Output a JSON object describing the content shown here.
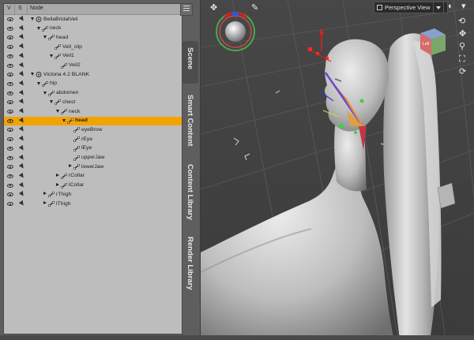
{
  "panel": {
    "columns": {
      "v": "V",
      "s": "S",
      "node": "Node"
    },
    "nodes": [
      {
        "label": "BellaBridalVeil",
        "level": 0,
        "type": "figure",
        "expanded": true,
        "selected": false
      },
      {
        "label": "neck",
        "level": 1,
        "type": "bone",
        "expanded": true,
        "selected": false
      },
      {
        "label": "head",
        "level": 2,
        "type": "bone",
        "expanded": true,
        "selected": false
      },
      {
        "label": "Veil_clip",
        "level": 3,
        "type": "bone",
        "expanded": false,
        "leaf": true,
        "selected": false
      },
      {
        "label": "Veil1",
        "level": 3,
        "type": "bone",
        "expanded": true,
        "selected": false
      },
      {
        "label": "Veil2",
        "level": 4,
        "type": "bone",
        "leaf": true,
        "selected": false
      },
      {
        "label": "Victoria 4.2 BLANK",
        "level": 0,
        "type": "figure",
        "expanded": true,
        "selected": false
      },
      {
        "label": "hip",
        "level": 1,
        "type": "bone",
        "expanded": true,
        "selected": false
      },
      {
        "label": "abdomen",
        "level": 2,
        "type": "bone",
        "expanded": true,
        "selected": false
      },
      {
        "label": "chest",
        "level": 3,
        "type": "bone",
        "expanded": true,
        "selected": false
      },
      {
        "label": "neck",
        "level": 4,
        "type": "bone",
        "expanded": true,
        "selected": false
      },
      {
        "label": "head",
        "level": 5,
        "type": "bone",
        "expanded": true,
        "selected": true
      },
      {
        "label": "eyeBrow",
        "level": 6,
        "type": "bone",
        "leaf": true,
        "selected": false
      },
      {
        "label": "rEye",
        "level": 6,
        "type": "bone",
        "leaf": true,
        "selected": false
      },
      {
        "label": "lEye",
        "level": 6,
        "type": "bone",
        "leaf": true,
        "selected": false
      },
      {
        "label": "upperJaw",
        "level": 6,
        "type": "bone",
        "leaf": true,
        "selected": false
      },
      {
        "label": "lowerJaw",
        "level": 6,
        "type": "bone",
        "expanded": false,
        "selected": false
      },
      {
        "label": "rCollar",
        "level": 4,
        "type": "bone",
        "expanded": false,
        "selected": false
      },
      {
        "label": "lCollar",
        "level": 4,
        "type": "bone",
        "expanded": false,
        "selected": false
      },
      {
        "label": "rThigh",
        "level": 2,
        "type": "bone",
        "expanded": false,
        "selected": false
      },
      {
        "label": "lThigh",
        "level": 2,
        "type": "bone",
        "expanded": false,
        "selected": false
      }
    ]
  },
  "tabs": [
    {
      "label": "Scene",
      "active": true
    },
    {
      "label": "Smart Content",
      "active": false
    },
    {
      "label": "Content Library",
      "active": false
    },
    {
      "label": "Render Library",
      "active": false
    }
  ],
  "viewport": {
    "camera_label": "Perspective View",
    "view_cube_label": "Left",
    "accent_color": "#f2a300",
    "icons": [
      "transform-tool-icon",
      "pin-icon",
      "orbit-icon",
      "pan-icon",
      "zoom-icon",
      "frame-icon",
      "reset-view-icon"
    ]
  }
}
